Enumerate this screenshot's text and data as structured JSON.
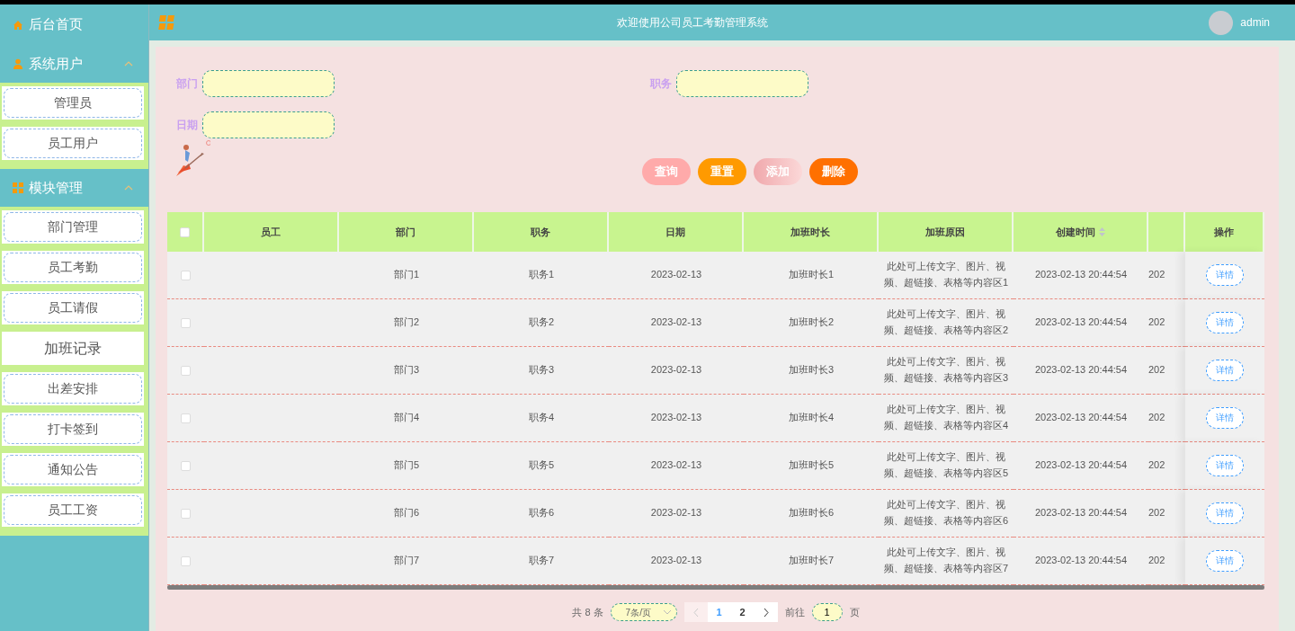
{
  "sidebar": {
    "home": {
      "label": "后台首页"
    },
    "groups": [
      {
        "title": "系统用户",
        "expanded": true,
        "items": [
          {
            "label": "管理员",
            "selected": false
          },
          {
            "label": "员工用户",
            "selected": false
          }
        ]
      },
      {
        "title": "模块管理",
        "expanded": true,
        "items": [
          {
            "label": "部门管理",
            "selected": false
          },
          {
            "label": "员工考勤",
            "selected": false
          },
          {
            "label": "员工请假",
            "selected": false
          },
          {
            "label": "加班记录",
            "selected": true
          },
          {
            "label": "出差安排",
            "selected": false
          },
          {
            "label": "打卡签到",
            "selected": false
          },
          {
            "label": "通知公告",
            "selected": false
          },
          {
            "label": "员工工资",
            "selected": false
          }
        ]
      }
    ]
  },
  "header": {
    "title": "欢迎使用公司员工考勤管理系统",
    "user": "admin"
  },
  "filters": [
    {
      "label": "部门"
    },
    {
      "label": "职务"
    },
    {
      "label": "日期"
    }
  ],
  "buttons": [
    {
      "label": "查询",
      "kind": "search"
    },
    {
      "label": "重置",
      "kind": "reset"
    },
    {
      "label": "添加",
      "kind": "add"
    },
    {
      "label": "删除",
      "kind": "delete"
    }
  ],
  "table": {
    "select_all": {
      "checked": false
    },
    "columns": [
      {
        "label": "员工"
      },
      {
        "label": "部门"
      },
      {
        "label": "职务"
      },
      {
        "label": "日期"
      },
      {
        "label": "加班时长"
      },
      {
        "label": "加班原因"
      },
      {
        "label": "创建时间",
        "sortable": true
      }
    ],
    "action_column": "操作",
    "rows": [
      {
        "checked": false,
        "department": "部门1",
        "position": "职务1",
        "date": "2023-02-13",
        "overtime_hours": "加班时长1",
        "overtime_reason": "此处可上传文字、图片、视频、超链接、表格等内容区1",
        "created": "2023-02-13 20:44:54",
        "column_9": "202",
        "action": "详情"
      },
      {
        "checked": false,
        "department": "部门2",
        "position": "职务2",
        "date": "2023-02-13",
        "overtime_hours": "加班时长2",
        "overtime_reason": "此处可上传文字、图片、视频、超链接、表格等内容区2",
        "created": "2023-02-13 20:44:54",
        "column_9": "202",
        "action": "详情"
      },
      {
        "checked": false,
        "department": "部门3",
        "position": "职务3",
        "date": "2023-02-13",
        "overtime_hours": "加班时长3",
        "overtime_reason": "此处可上传文字、图片、视频、超链接、表格等内容区3",
        "created": "2023-02-13 20:44:54",
        "column_9": "202",
        "action": "详情"
      },
      {
        "checked": false,
        "department": "部门4",
        "position": "职务4",
        "date": "2023-02-13",
        "overtime_hours": "加班时长4",
        "overtime_reason": "此处可上传文字、图片、视频、超链接、表格等内容区4",
        "created": "2023-02-13 20:44:54",
        "column_9": "202",
        "action": "详情"
      },
      {
        "checked": false,
        "department": "部门5",
        "position": "职务5",
        "date": "2023-02-13",
        "overtime_hours": "加班时长5",
        "overtime_reason": "此处可上传文字、图片、视频、超链接、表格等内容区5",
        "created": "2023-02-13 20:44:54",
        "column_9": "202",
        "action": "详情"
      },
      {
        "checked": false,
        "department": "部门6",
        "position": "职务6",
        "date": "2023-02-13",
        "overtime_hours": "加班时长6",
        "overtime_reason": "此处可上传文字、图片、视频、超链接、表格等内容区6",
        "created": "2023-02-13 20:44:54",
        "column_9": "202",
        "action": "详情"
      },
      {
        "checked": false,
        "department": "部门7",
        "position": "职务7",
        "date": "2023-02-13",
        "overtime_hours": "加班时长7",
        "overtime_reason": "此处可上传文字、图片、视频、超链接、表格等内容区7",
        "created": "2023-02-13 20:44:54",
        "column_9": "202",
        "action": "详情"
      }
    ]
  },
  "pagination": {
    "total": "共 8 条",
    "page_size": "7条/页",
    "pages": [
      {
        "label": "1",
        "selected": true
      },
      {
        "label": "2",
        "selected": false
      }
    ],
    "goto_label": "前往",
    "goto_value": "1",
    "goto_suffix": "页"
  }
}
